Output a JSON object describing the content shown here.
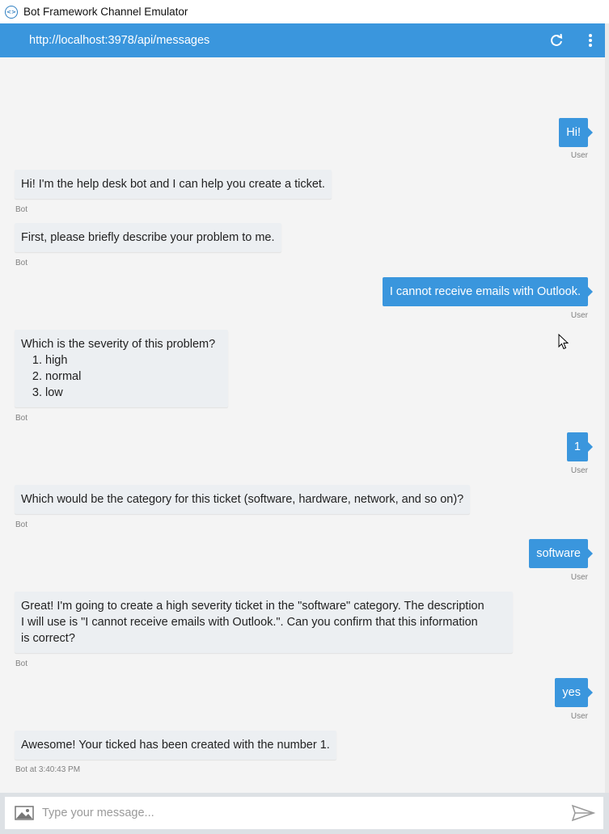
{
  "window": {
    "title": "Bot Framework Channel Emulator"
  },
  "header": {
    "endpoint": "http://localhost:3978/api/messages"
  },
  "messages": [
    {
      "from": "user",
      "text": "Hi!",
      "meta": "User"
    },
    {
      "from": "bot",
      "text": "Hi! I'm the help desk bot and I can help you create a ticket.",
      "meta": "Bot"
    },
    {
      "from": "bot",
      "text": "First, please briefly describe your problem to me.",
      "meta": "Bot"
    },
    {
      "from": "user",
      "text": "I cannot receive emails with Outlook.",
      "meta": "User"
    },
    {
      "from": "bot",
      "text": "Which is the severity of this problem?",
      "choices": [
        "high",
        "normal",
        "low"
      ],
      "meta": "Bot"
    },
    {
      "from": "user",
      "text": "1",
      "meta": "User"
    },
    {
      "from": "bot",
      "text": "Which would be the category for this ticket (software, hardware, network, and so on)?",
      "meta": "Bot"
    },
    {
      "from": "user",
      "text": "software",
      "meta": "User"
    },
    {
      "from": "bot",
      "lines": [
        "Great! I'm going to create a high severity ticket in the \"software\" category. The description",
        "I will use is \"I cannot receive emails with Outlook.\". Can you confirm that this information",
        "is correct?"
      ],
      "meta": "Bot"
    },
    {
      "from": "user",
      "text": "yes",
      "meta": "User"
    },
    {
      "from": "bot",
      "text": "Awesome! Your ticked has been created with the number 1.",
      "meta": "Bot at 3:40:43 PM"
    }
  ],
  "composer": {
    "placeholder": "Type your message..."
  },
  "colors": {
    "accent": "#3a96dd",
    "bot_bubble": "#eceff2",
    "background": "#f4f4f4"
  }
}
